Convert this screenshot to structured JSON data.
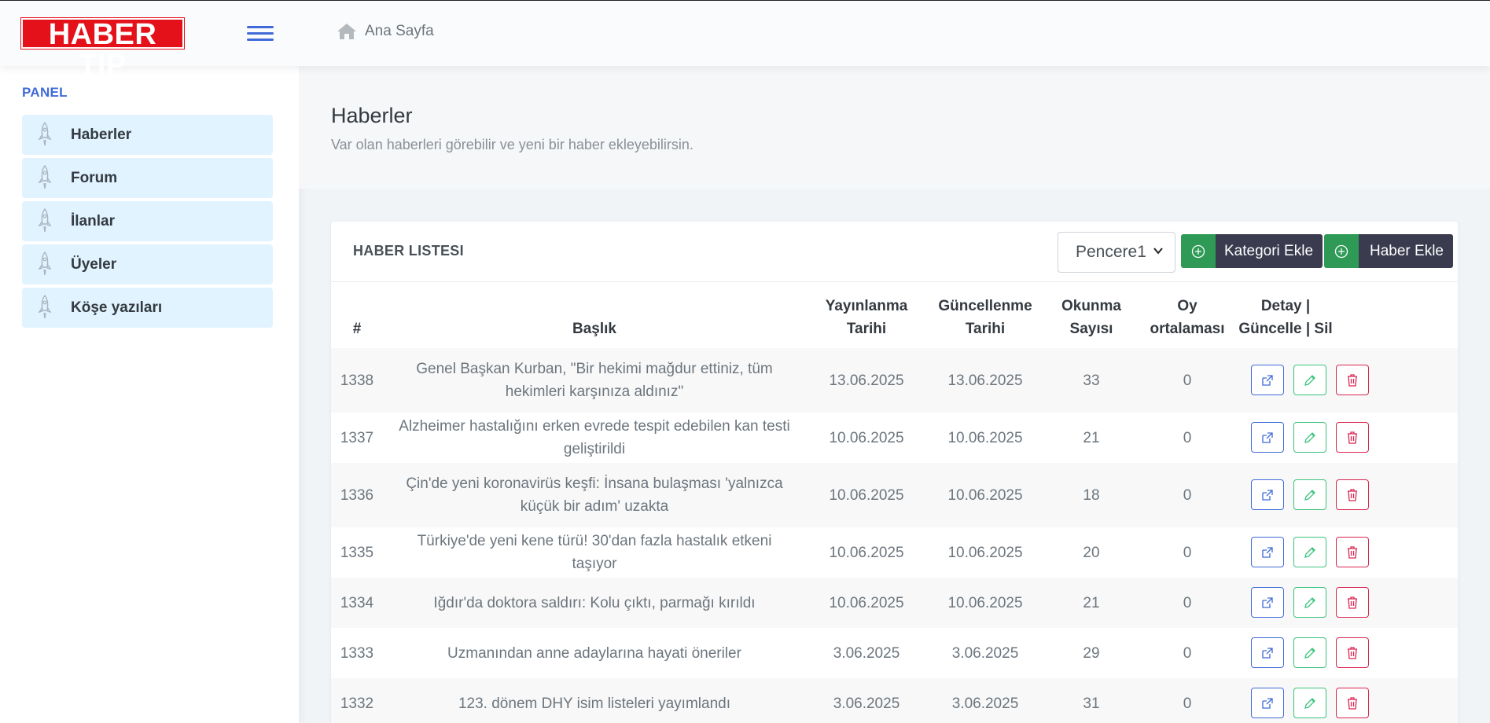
{
  "brand": {
    "logo_text": "HABER TIP"
  },
  "breadcrumb": {
    "label": "Ana Sayfa"
  },
  "sidebar": {
    "title": "PANEL",
    "items": [
      {
        "label": "Haberler"
      },
      {
        "label": "Forum"
      },
      {
        "label": "İlanlar"
      },
      {
        "label": "Üyeler"
      },
      {
        "label": "Köşe yazıları"
      }
    ]
  },
  "page": {
    "title": "Haberler",
    "subtitle": "Var olan haberleri görebilir ve yeni bir haber ekleyebilirsin."
  },
  "card": {
    "title": "HABER LISTESI",
    "select_value": "Pencere1",
    "add_category_label": "Kategori Ekle",
    "add_news_label": "Haber Ekle"
  },
  "table": {
    "headers": {
      "id": "#",
      "title": "Başlık",
      "published_1": "Yayınlanma",
      "published_2": "Tarihi",
      "updated_1": "Güncellenme",
      "updated_2": "Tarihi",
      "reads_1": "Okunma",
      "reads_2": "Sayısı",
      "rating_1": "Oy",
      "rating_2": "ortalaması",
      "actions_1": "Detay |",
      "actions_2": "Güncelle | Sil"
    },
    "rows": [
      {
        "id": "1338",
        "title": "Genel Başkan Kurban, \"Bir hekimi mağdur ettiniz, tüm hekimleri karşınıza aldınız\"",
        "published": "13.06.2025",
        "updated": "13.06.2025",
        "reads": "33",
        "rating": "0"
      },
      {
        "id": "1337",
        "title": "Alzheimer hastalığını erken evrede tespit edebilen kan testi geliştirildi",
        "published": "10.06.2025",
        "updated": "10.06.2025",
        "reads": "21",
        "rating": "0"
      },
      {
        "id": "1336",
        "title": "Çin'de yeni koronavirüs keşfi: İnsana bulaşması 'yalnızca küçük bir adım' uzakta",
        "published": "10.06.2025",
        "updated": "10.06.2025",
        "reads": "18",
        "rating": "0"
      },
      {
        "id": "1335",
        "title": "Türkiye'de yeni kene türü! 30'dan fazla hastalık etkeni taşıyor",
        "published": "10.06.2025",
        "updated": "10.06.2025",
        "reads": "20",
        "rating": "0"
      },
      {
        "id": "1334",
        "title": "Iğdır'da doktora saldırı: Kolu çıktı, parmağı kırıldı",
        "published": "10.06.2025",
        "updated": "10.06.2025",
        "reads": "21",
        "rating": "0"
      },
      {
        "id": "1333",
        "title": "Uzmanından anne adaylarına hayati öneriler",
        "published": "3.06.2025",
        "updated": "3.06.2025",
        "reads": "29",
        "rating": "0"
      },
      {
        "id": "1332",
        "title": "123. dönem DHY isim listeleri yayımlandı",
        "published": "3.06.2025",
        "updated": "3.06.2025",
        "reads": "31",
        "rating": "0"
      }
    ]
  },
  "icons": {
    "home": "home-icon",
    "rocket": "rocket-icon",
    "plus": "plus-circle-icon",
    "detail": "external-link-icon",
    "edit": "pencil-icon",
    "delete": "trash-icon"
  },
  "colors": {
    "primary": "#3f6ad8",
    "success": "#3ac47d",
    "danger": "#d92550",
    "button_dark": "#3a3b4f",
    "button_green": "#2e9a56",
    "logo_red": "#e4101a",
    "nav_bg": "#e0f3ff"
  }
}
